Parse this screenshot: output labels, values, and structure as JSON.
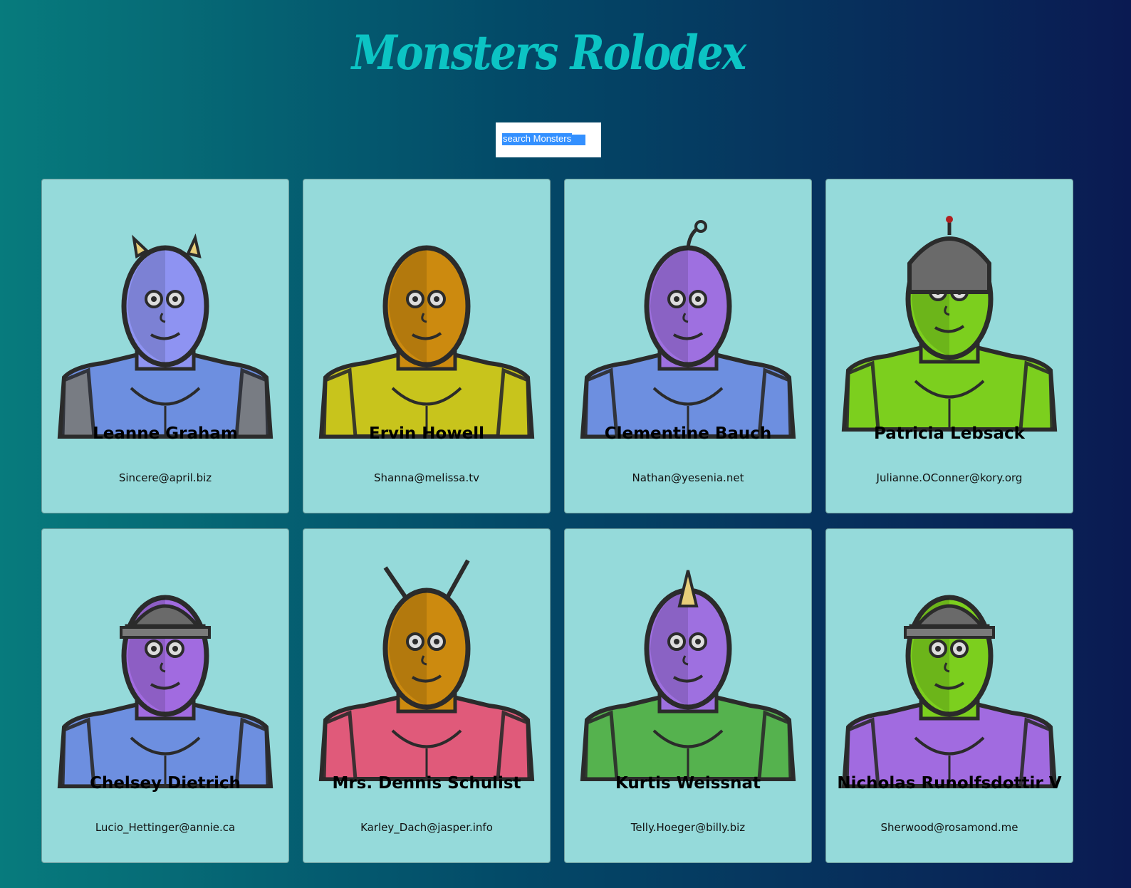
{
  "app": {
    "title": "Monsters Rolodex"
  },
  "search": {
    "placeholder": "search Monsters",
    "value": ""
  },
  "monsters": [
    {
      "name": "Leanne Graham",
      "email": "Sincere@april.biz",
      "skin": "#8e93f2",
      "body": "#6d8fe0",
      "shoulder": "#7a7a7a",
      "feature": "horns"
    },
    {
      "name": "Ervin Howell",
      "email": "Shanna@melissa.tv",
      "skin": "#cc8a0f",
      "body": "#c8c41c",
      "shoulder": "#c8c41c",
      "feature": "none"
    },
    {
      "name": "Clementine Bauch",
      "email": "Nathan@yesenia.net",
      "skin": "#9e70e0",
      "body": "#6d8fe0",
      "shoulder": "#6d8fe0",
      "feature": "antenna"
    },
    {
      "name": "Patricia Lebsack",
      "email": "Julianne.OConner@kory.org",
      "skin": "#7ccf1e",
      "body": "#7ccf1e",
      "shoulder": "#7ccf1e",
      "feature": "helmet"
    },
    {
      "name": "Chelsey Dietrich",
      "email": "Lucio_Hettinger@annie.ca",
      "skin": "#a16be0",
      "body": "#6d8fe0",
      "shoulder": "#6d8fe0",
      "feature": "visor"
    },
    {
      "name": "Mrs. Dennis Schulist",
      "email": "Karley_Dach@jasper.info",
      "skin": "#cc8a0f",
      "body": "#e05a7a",
      "shoulder": "#e05a7a",
      "feature": "antennae"
    },
    {
      "name": "Kurtis Weissnat",
      "email": "Telly.Hoeger@billy.biz",
      "skin": "#9e70e0",
      "body": "#55b24e",
      "shoulder": "#55b24e",
      "feature": "horn"
    },
    {
      "name": "Nicholas Runolfsdottir V",
      "email": "Sherwood@rosamond.me",
      "skin": "#7ccf1e",
      "body": "#a16be0",
      "shoulder": "#a16be0",
      "feature": "visor"
    }
  ]
}
